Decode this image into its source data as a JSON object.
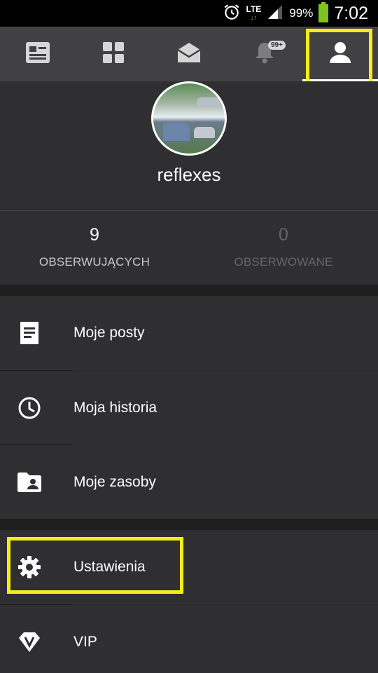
{
  "status_bar": {
    "network": "LTE",
    "battery_percent": "99%",
    "time": "7:02",
    "icons": [
      "alarm-icon",
      "lte-icon",
      "signal-icon",
      "battery-icon"
    ]
  },
  "tabs": [
    {
      "icon": "news-icon",
      "active": false
    },
    {
      "icon": "grid-icon",
      "active": false
    },
    {
      "icon": "mail-icon",
      "active": false
    },
    {
      "icon": "bell-icon",
      "badge": "99+",
      "active": false
    },
    {
      "icon": "person-icon",
      "active": true
    }
  ],
  "profile": {
    "username": "reflexes",
    "avatar": "camping-photo-avatar"
  },
  "stats": {
    "followers_count": "9",
    "followers_label": "OBSERWUJĄCYCH",
    "following_count": "0",
    "following_label": "OBSERWOWANE"
  },
  "menu": {
    "my_posts": "Moje posty",
    "my_history": "Moja historia",
    "my_resources": "Moje zasoby",
    "settings": "Ustawienia",
    "vip": "VIP"
  },
  "colors": {
    "highlight": "#f3ee1a",
    "battery": "#7ec31f",
    "background": "#2b2b2d",
    "tabbar": "#414143"
  }
}
